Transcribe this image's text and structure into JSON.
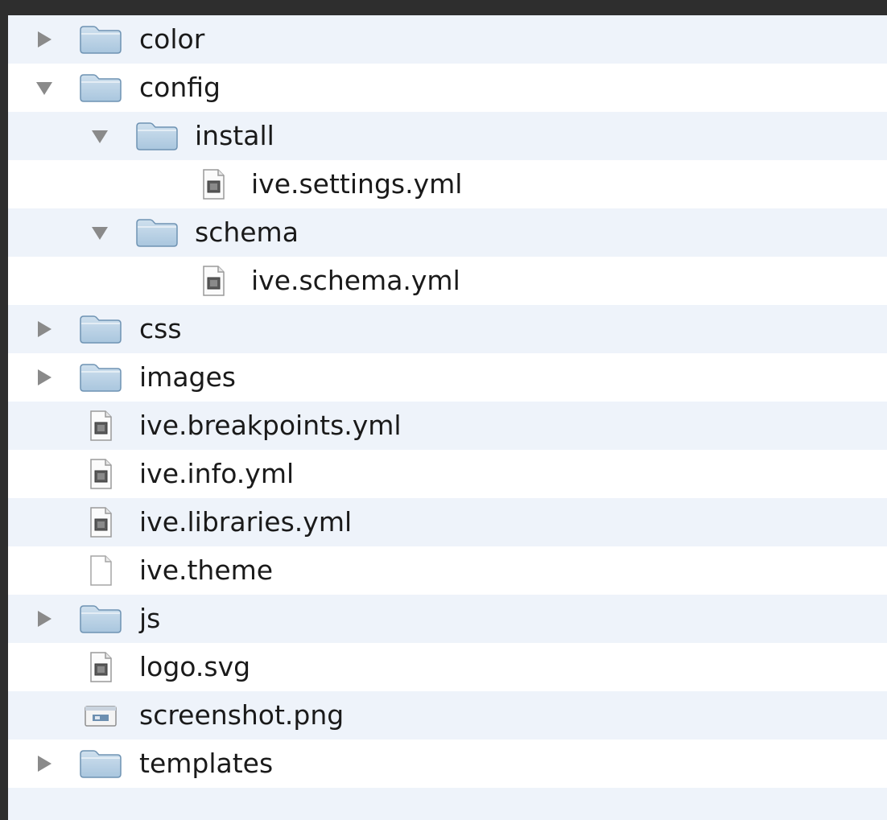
{
  "tree": {
    "rows": [
      {
        "label": "color",
        "kind": "folder",
        "expanded": false,
        "depth": 0
      },
      {
        "label": "config",
        "kind": "folder",
        "expanded": true,
        "depth": 0
      },
      {
        "label": "install",
        "kind": "folder",
        "expanded": true,
        "depth": 1
      },
      {
        "label": "ive.settings.yml",
        "kind": "doc",
        "depth": 2
      },
      {
        "label": "schema",
        "kind": "folder",
        "expanded": true,
        "depth": 1
      },
      {
        "label": "ive.schema.yml",
        "kind": "doc",
        "depth": 2
      },
      {
        "label": "css",
        "kind": "folder",
        "expanded": false,
        "depth": 0
      },
      {
        "label": "images",
        "kind": "folder",
        "expanded": false,
        "depth": 0
      },
      {
        "label": "ive.breakpoints.yml",
        "kind": "doc",
        "depth": 0
      },
      {
        "label": "ive.info.yml",
        "kind": "doc",
        "depth": 0
      },
      {
        "label": "ive.libraries.yml",
        "kind": "doc",
        "depth": 0
      },
      {
        "label": "ive.theme",
        "kind": "blank",
        "depth": 0
      },
      {
        "label": "js",
        "kind": "folder",
        "expanded": false,
        "depth": 0
      },
      {
        "label": "logo.svg",
        "kind": "doc",
        "depth": 0
      },
      {
        "label": "screenshot.png",
        "kind": "image",
        "depth": 0
      },
      {
        "label": "templates",
        "kind": "folder",
        "expanded": false,
        "depth": 0
      }
    ]
  },
  "colors": {
    "stripe": "#eef3fa",
    "folder_top": "#cfe0ee",
    "folder_body": "#a9c6de",
    "folder_edge": "#6f93b3",
    "disclosure": "#8a8a8a"
  }
}
